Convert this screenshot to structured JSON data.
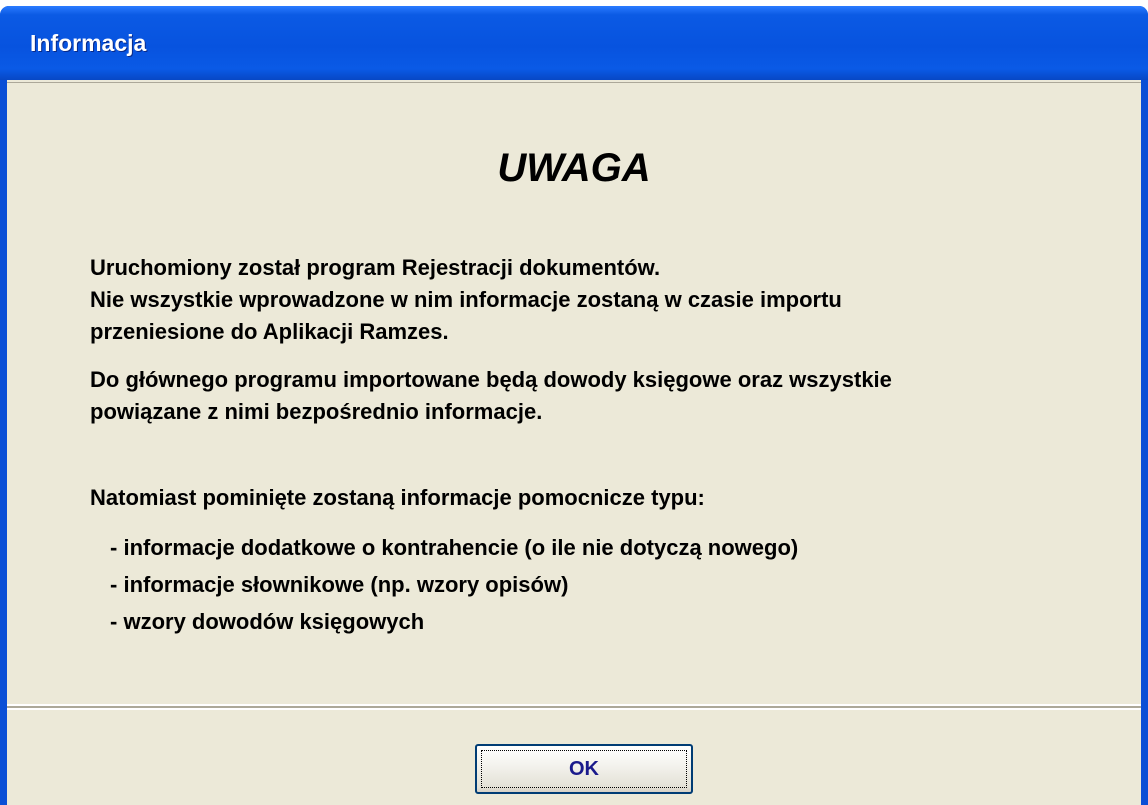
{
  "window": {
    "title": "Informacja"
  },
  "message": {
    "heading": "UWAGA",
    "paragraph1": [
      "Uruchomiony został program Rejestracji dokumentów.",
      "Nie wszystkie wprowadzone w nim informacje zostaną w czasie importu",
      "przeniesione do Aplikacji Ramzes."
    ],
    "paragraph2": [
      "Do głównego programu importowane będą dowody księgowe oraz wszystkie",
      "powiązane z nimi bezpośrednio informacje."
    ],
    "paragraph3": "Natomiast pominięte zostaną informacje pomocnicze typu:",
    "items": [
      "informacje dodatkowe o kontrahencie (o ile nie dotyczą nowego)",
      "informacje słownikowe (np. wzory opisów)",
      "wzory dowodów księgowych"
    ]
  },
  "buttons": {
    "ok_label": "OK"
  },
  "colors": {
    "titlebar": "#0753df",
    "dialog_background": "#ece9d8",
    "button_border": "#003c74",
    "button_text": "#1a1a8c"
  }
}
